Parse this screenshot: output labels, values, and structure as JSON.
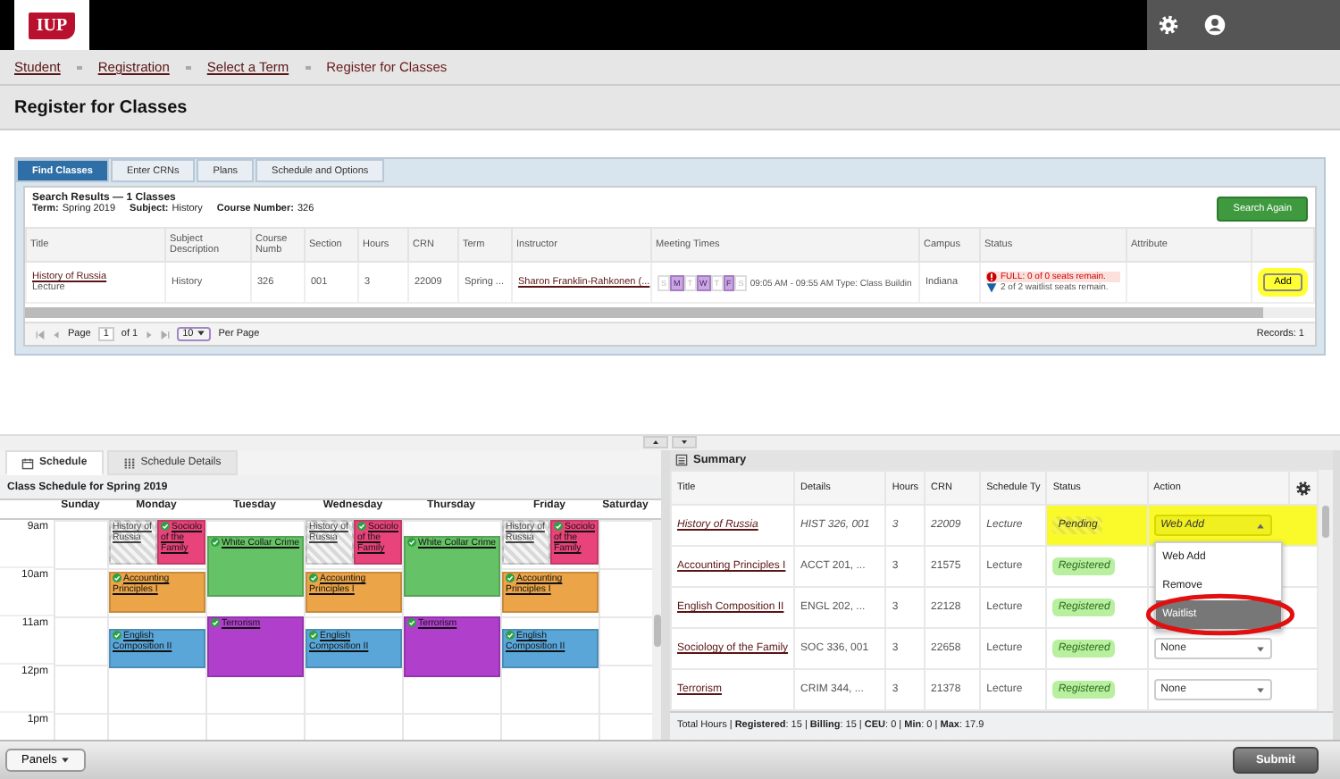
{
  "header": {
    "logo": "IUP"
  },
  "breadcrumb": [
    {
      "label": "Student",
      "link": true
    },
    {
      "label": "Registration",
      "link": true
    },
    {
      "label": "Select a Term",
      "link": true
    },
    {
      "label": "Register for Classes",
      "link": false
    }
  ],
  "page_title": "Register for Classes",
  "tabs": [
    {
      "label": "Find Classes",
      "selected": true
    },
    {
      "label": "Enter CRNs",
      "selected": false
    },
    {
      "label": "Plans",
      "selected": false
    },
    {
      "label": "Schedule and Options",
      "selected": false
    }
  ],
  "search_results": {
    "heading": "Search Results — 1 Classes",
    "criteria": [
      {
        "label": "Term:",
        "value": "Spring 2019"
      },
      {
        "label": "Subject:",
        "value": "History"
      },
      {
        "label": "Course Number:",
        "value": "326"
      }
    ],
    "search_again": "Search Again",
    "columns": [
      "Title",
      "Subject Description",
      "Course Numb",
      "Section",
      "Hours",
      "CRN",
      "Term",
      "Instructor",
      "Meeting Times",
      "Campus",
      "Status",
      "Attribute"
    ],
    "rows": [
      {
        "title": "History of Russia",
        "schedule_type": "Lecture",
        "subject": "History",
        "course_number": "326",
        "section": "001",
        "hours": "3",
        "crn": "22009",
        "term": "Spring ...",
        "instructor": "Sharon Franklin-Rahkonen (...",
        "meeting_days": [
          {
            "label": "S",
            "active": false
          },
          {
            "label": "M",
            "active": true
          },
          {
            "label": "T",
            "active": false
          },
          {
            "label": "W",
            "active": true
          },
          {
            "label": "T",
            "active": false
          },
          {
            "label": "F",
            "active": true
          },
          {
            "label": "S",
            "active": false
          }
        ],
        "meeting_text": "09:05 AM - 09:55 AM Type: Class Buildin",
        "campus": "Indiana",
        "status": [
          {
            "kind": "full",
            "text": "FULL: 0 of 0 seats remain."
          },
          {
            "kind": "waitlist",
            "text": "2 of 2 waitlist seats remain."
          }
        ],
        "action": {
          "label": "Add",
          "highlighted": true
        }
      }
    ],
    "pager": {
      "page_label": "Page",
      "page": "1",
      "of": "of 1",
      "per_page": "10",
      "per_page_label": "Per Page",
      "records": "Records: 1"
    }
  },
  "schedule": {
    "tabs": [
      {
        "label": "Schedule",
        "selected": true
      },
      {
        "label": "Schedule Details",
        "selected": false
      }
    ],
    "title": "Class Schedule for Spring 2019",
    "hours": [
      "9am",
      "10am",
      "11am",
      "12pm",
      "1pm"
    ],
    "days": [
      {
        "name": "Sunday"
      },
      {
        "name": "Monday",
        "events": [
          {
            "title": "History of Russia",
            "color": "#d9d9d9",
            "pending": true
          },
          {
            "title": "Sociolo of the Family",
            "color": "#e8437a",
            "pending": false
          },
          {
            "title": "Accounting Principles I",
            "color": "#eba447",
            "pending": false
          },
          {
            "title": "English Composition II",
            "color": "#5aa6d8",
            "pending": false
          }
        ]
      },
      {
        "name": "Tuesday",
        "events": [
          {
            "title": "White Collar Crime",
            "color": "#66c266",
            "pending": false
          },
          {
            "title": "Terrorism",
            "color": "#b03fcc",
            "pending": false
          }
        ]
      },
      {
        "name": "Wednesday",
        "events": [
          {
            "title": "History of Russia",
            "color": "#d9d9d9",
            "pending": true
          },
          {
            "title": "Sociolo of the Family",
            "color": "#e8437a",
            "pending": false
          },
          {
            "title": "Accounting Principles I",
            "color": "#eba447",
            "pending": false
          },
          {
            "title": "English Composition II",
            "color": "#5aa6d8",
            "pending": false
          }
        ]
      },
      {
        "name": "Thursday",
        "events": [
          {
            "title": "White Collar Crime",
            "color": "#66c266",
            "pending": false
          },
          {
            "title": "Terrorism",
            "color": "#b03fcc",
            "pending": false
          }
        ]
      },
      {
        "name": "Friday",
        "events": [
          {
            "title": "History of Russia",
            "color": "#d9d9d9",
            "pending": true
          },
          {
            "title": "Sociolo of the Family",
            "color": "#e8437a",
            "pending": false
          },
          {
            "title": "Accounting Principles I",
            "color": "#eba447",
            "pending": false
          },
          {
            "title": "English Composition II",
            "color": "#5aa6d8",
            "pending": false
          }
        ]
      },
      {
        "name": "Saturday"
      }
    ]
  },
  "summary": {
    "title": "Summary",
    "columns": [
      "Title",
      "Details",
      "Hours",
      "CRN",
      "Schedule Ty",
      "Status",
      "Action"
    ],
    "rows": [
      {
        "title": "History of Russia",
        "details": "HIST 326, 001",
        "hours": "3",
        "crn": "22009",
        "schedule_type": "Lecture",
        "status": "Pending",
        "kind": "pending",
        "action": "Web Add",
        "highlighted": true
      },
      {
        "title": "Accounting Principles I",
        "details": "ACCT 201, ...",
        "hours": "3",
        "crn": "21575",
        "schedule_type": "Lecture",
        "status": "Registered",
        "kind": "registered",
        "highlighted": false
      },
      {
        "title": "English Composition II",
        "details": "ENGL 202, ...",
        "hours": "3",
        "crn": "22128",
        "schedule_type": "Lecture",
        "status": "Registered",
        "kind": "registered",
        "highlighted": false
      },
      {
        "title": "Sociology of the Family",
        "details": "SOC 336, 001",
        "hours": "3",
        "crn": "22658",
        "schedule_type": "Lecture",
        "status": "Registered",
        "kind": "registered",
        "action": "None",
        "highlighted": false
      },
      {
        "title": "Terrorism",
        "details": "CRIM 344, ...",
        "hours": "3",
        "crn": "21378",
        "schedule_type": "Lecture",
        "status": "Registered",
        "kind": "registered",
        "action": "None",
        "highlighted": false
      }
    ],
    "dropdown": {
      "options": [
        {
          "label": "Web Add",
          "selected": false,
          "circled": false
        },
        {
          "label": "Remove",
          "selected": false,
          "circled": false
        },
        {
          "label": "Waitlist",
          "selected": true,
          "circled": true
        }
      ]
    },
    "totals": "Total Hours | **Registered**: 15 | **Billing**: 15 | **CEU**: 0 | **Min**: 0 | **Max**: 17.9"
  },
  "footer": {
    "panels": "Panels",
    "submit": "Submit"
  }
}
